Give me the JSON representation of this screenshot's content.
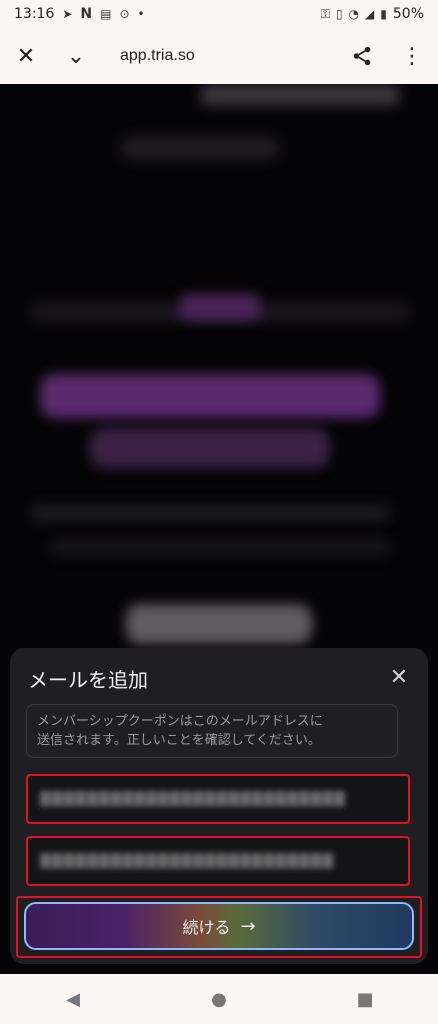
{
  "status_bar": {
    "time": "13:16",
    "battery": "50%",
    "left_icons": [
      "telegram-icon",
      "n-icon",
      "news-icon",
      "location-icon",
      "dot-icon"
    ],
    "right_icons": [
      "key-icon",
      "vibrate-icon",
      "wifi-icon",
      "signal-icon",
      "battery-icon"
    ]
  },
  "toolbar": {
    "url": "app.tria.so"
  },
  "sheet": {
    "title": "メールを追加",
    "note_line1": "メンバーシップクーポンはこのメールアドレスに",
    "note_line2": "送信されます。正しいことを確認してください。",
    "field1_value": "▒▒▒▒▒▒▒▒▒▒▒▒▒▒▒▒▒▒▒▒▒▒▒▒▒▒",
    "field2_value": "▒▒▒▒▒▒▒▒▒▒▒▒▒▒▒▒▒▒▒▒▒▒▒▒▒",
    "continue_label": "続ける"
  },
  "colors": {
    "highlight": "#e0102a",
    "sheet_bg": "#1f1f22",
    "chrome_bg": "#fdf7f3"
  }
}
